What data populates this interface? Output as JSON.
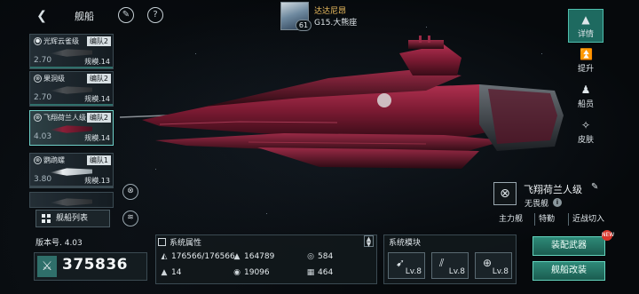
{
  "header": {
    "title": "舰船",
    "back_icon": "chevron-left-icon",
    "icons": [
      "wrench-icon",
      "help-icon"
    ]
  },
  "player": {
    "name": "达达尼昂",
    "level": "61",
    "location": "G15.大熊座"
  },
  "ship_list": [
    {
      "name": "光辉云雀级",
      "fleet": "编队2",
      "cost": "2.70",
      "scale": "规模.14",
      "selected": false
    },
    {
      "name": "果洞级",
      "fleet": "编队2",
      "cost": "2.70",
      "scale": "规模.14",
      "selected": false
    },
    {
      "name": "飞翔荷兰人级",
      "fleet": "编队2",
      "cost": "4.03",
      "scale": "规模.14",
      "selected": true
    },
    {
      "name": "鹦鹉螺",
      "fleet": "编队1",
      "cost": "3.80",
      "scale": "规模.13",
      "selected": false
    }
  ],
  "fleet_list_button": "舰船列表",
  "side_tabs": [
    {
      "label": "详情",
      "icon": "details-icon",
      "active": true
    },
    {
      "label": "提升",
      "icon": "upgrade-icon",
      "active": false
    },
    {
      "label": "船员",
      "icon": "crew-icon",
      "active": false
    },
    {
      "label": "皮肤",
      "icon": "skin-icon",
      "active": false
    }
  ],
  "ship_info": {
    "class_name": "飞翔荷兰人级",
    "role": "无畏舰",
    "tags": [
      "主力舰",
      "特勤",
      "近战切入"
    ]
  },
  "version": {
    "label": "版本号. 4.03"
  },
  "power": "375836",
  "attributes": {
    "title": "系统属性",
    "items": [
      {
        "icon": "structure-icon",
        "value": "176566/176566"
      },
      {
        "icon": "armor-icon",
        "value": "164789"
      },
      {
        "icon": "shield-icon",
        "value": "584"
      },
      {
        "icon": "speed-icon",
        "value": "14"
      },
      {
        "icon": "energy-icon",
        "value": "19096"
      },
      {
        "icon": "evasion-icon",
        "value": "464"
      }
    ]
  },
  "modules": {
    "title": "系统模块",
    "items": [
      {
        "icon": "missile-module-icon",
        "level": "Lv.8"
      },
      {
        "icon": "cannon-module-icon",
        "level": "Lv.8"
      },
      {
        "icon": "target-module-icon",
        "level": "Lv.8"
      }
    ]
  },
  "actions": {
    "equip_weapons": "装配武器",
    "modify_ship": "舰船改装",
    "new_badge": "NEW"
  }
}
